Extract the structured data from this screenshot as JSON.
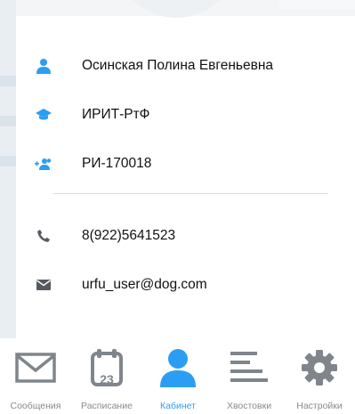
{
  "colors": {
    "accent": "#2b9ef3",
    "tab_inactive": "#8a8a8a",
    "text": "#111111",
    "divider": "#d8dde2"
  },
  "profile": {
    "full_name": "Осинская Полина Евгеньевна",
    "institute": "ИРИТ-РтФ",
    "group": "РИ-170018",
    "phone": "8(922)5641523",
    "email": "urfu_user@dog.com"
  },
  "profile_icons": {
    "name": "person-icon",
    "institute": "graduation-cap-icon",
    "group": "group-icon",
    "phone": "phone-icon",
    "email": "mail-icon"
  },
  "tabbar": {
    "active": "Кабинет",
    "calendar_day": "23",
    "tabs": [
      {
        "label": "Сообщения",
        "icon": "envelope-icon"
      },
      {
        "label": "Расписание",
        "icon": "calendar-icon"
      },
      {
        "label": "Кабинет",
        "icon": "person-icon"
      },
      {
        "label": "Хвостовки",
        "icon": "list-icon"
      },
      {
        "label": "Настройки",
        "icon": "gear-icon"
      }
    ]
  }
}
